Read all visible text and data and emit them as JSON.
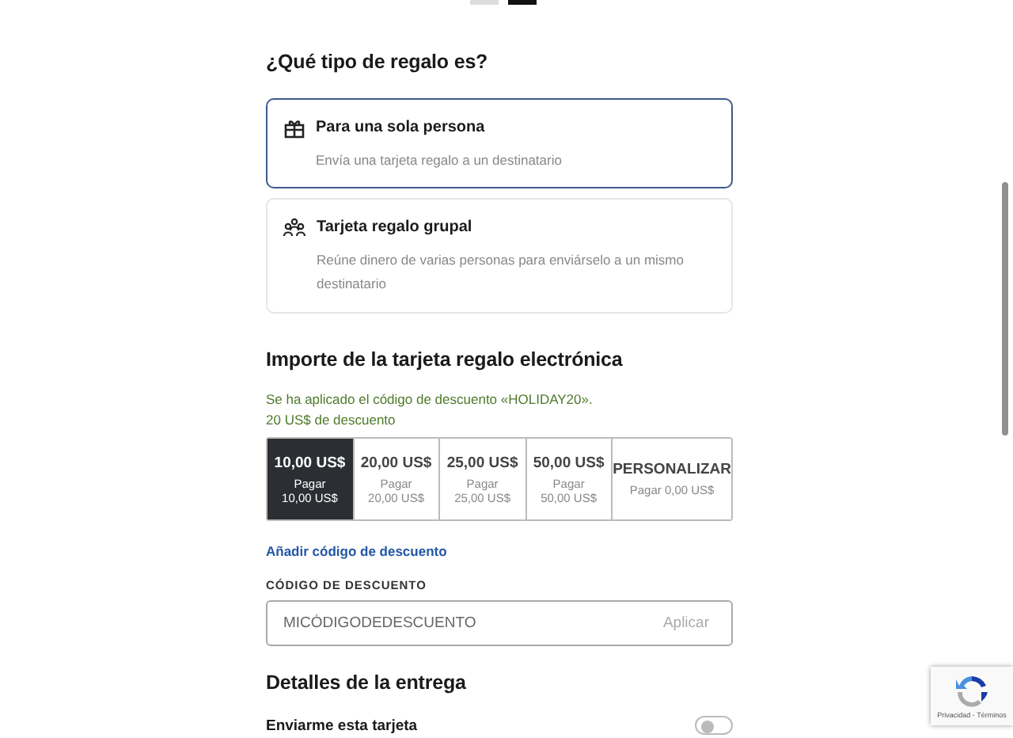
{
  "slide_dots": [
    {
      "selected": false
    },
    {
      "selected": true
    }
  ],
  "gift_type": {
    "title": "¿Qué tipo de regalo es?",
    "options": [
      {
        "kind": "gift",
        "title": "Para una sola persona",
        "description": "Envía una tarjeta regalo a un destinatario",
        "selected": true
      },
      {
        "kind": "group",
        "title": "Tarjeta regalo grupal",
        "description": "Reúne dinero de varias personas para enviárselo a un mismo destinatario",
        "selected": false
      }
    ]
  },
  "amount": {
    "title": "Importe de la tarjeta regalo electrónica",
    "discount_notice": [
      "Se ha aplicado el código de descuento «HOLIDAY20».",
      "20 US$ de descuento"
    ],
    "options": [
      {
        "amount": "10,00 US$",
        "pay_label": "Pagar",
        "pay": "10,00 US$",
        "selected": true
      },
      {
        "amount": "20,00 US$",
        "pay_label": "Pagar",
        "pay": "20,00 US$",
        "selected": false
      },
      {
        "amount": "25,00 US$",
        "pay_label": "Pagar",
        "pay": "25,00 US$",
        "selected": false
      },
      {
        "amount": "50,00 US$",
        "pay_label": "Pagar",
        "pay": "50,00 US$",
        "selected": false
      },
      {
        "amount": "PERSONALIZAR",
        "pay_label": "Pagar 0,00 US$",
        "selected": false
      }
    ],
    "add_code_link": "Añadir código de descuento",
    "code_label": "CÓDIGO DE DESCUENTO",
    "code_placeholder": "MICÓDIGODEDESCUENTO",
    "apply_button": "Aplicar"
  },
  "delivery": {
    "title": "Detalles de la entrega",
    "send_to_me": {
      "label": "Enviarme esta tarjeta",
      "on": false
    }
  },
  "recaptcha": {
    "links": "Privacidad - Términos"
  }
}
